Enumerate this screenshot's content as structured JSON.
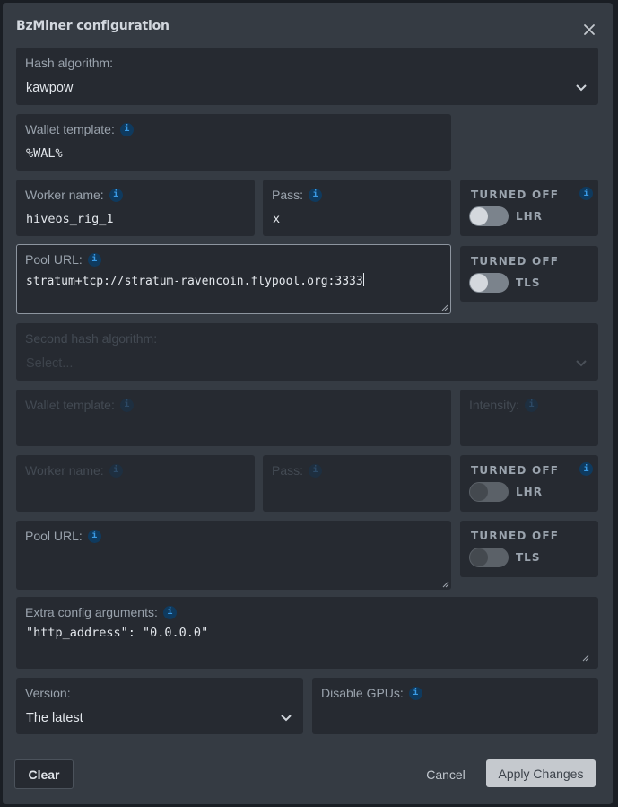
{
  "dialog": {
    "title": "BzMiner configuration"
  },
  "primary": {
    "hash_algorithm": {
      "label": "Hash algorithm:",
      "value": "kawpow"
    },
    "wallet_template": {
      "label": "Wallet template:",
      "value": "%WAL%"
    },
    "worker_name": {
      "label": "Worker name:",
      "value": "hiveos_rig_1"
    },
    "pass": {
      "label": "Pass:",
      "value": "x"
    },
    "lhr": {
      "state": "TURNED OFF",
      "label": "LHR",
      "on": false
    },
    "pool_url": {
      "label": "Pool URL:",
      "value": "stratum+tcp://stratum-ravencoin.flypool.org:3333"
    },
    "tls": {
      "state": "TURNED OFF",
      "label": "TLS",
      "on": false
    }
  },
  "secondary": {
    "hash_algorithm": {
      "label": "Second hash algorithm:",
      "placeholder": "Select..."
    },
    "wallet_template": {
      "label": "Wallet template:",
      "value": ""
    },
    "intensity": {
      "label": "Intensity:",
      "value": ""
    },
    "worker_name": {
      "label": "Worker name:",
      "value": ""
    },
    "pass": {
      "label": "Pass:",
      "value": ""
    },
    "lhr": {
      "state": "TURNED OFF",
      "label": "LHR",
      "on": false
    },
    "pool_url": {
      "label": "Pool URL:",
      "value": ""
    },
    "tls": {
      "state": "TURNED OFF",
      "label": "TLS",
      "on": false
    }
  },
  "extra_config": {
    "label": "Extra config arguments:",
    "value": "\"http_address\": \"0.0.0.0\""
  },
  "version": {
    "label": "Version:",
    "value": "The latest"
  },
  "disable_gpus": {
    "label": "Disable GPUs:",
    "value": ""
  },
  "footer": {
    "clear_label": "Clear",
    "cancel_label": "Cancel",
    "apply_label": "Apply Changes"
  },
  "icons": {
    "info": "i",
    "close": "close-icon",
    "chevron": "chevron-down-icon"
  }
}
